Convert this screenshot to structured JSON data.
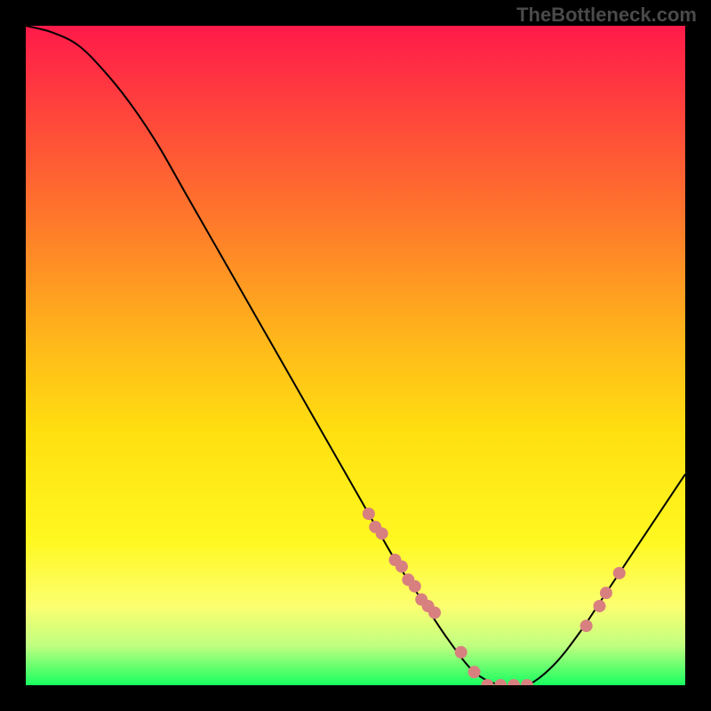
{
  "watermark": "TheBottleneck.com",
  "chart_data": {
    "type": "line",
    "title": "",
    "xlabel": "",
    "ylabel": "",
    "xlim": [
      0,
      100
    ],
    "ylim": [
      0,
      100
    ],
    "description": "V-shaped bottleneck curve over rainbow gradient; y approximates percent bottleneck (0 = green/bottom, 100 = red/top); minimum near x≈70",
    "series": [
      {
        "name": "curve",
        "x": [
          0,
          4,
          8,
          12,
          16,
          20,
          24,
          28,
          32,
          36,
          40,
          44,
          48,
          52,
          56,
          60,
          64,
          68,
          72,
          76,
          80,
          84,
          88,
          92,
          96,
          100
        ],
        "y": [
          100,
          99,
          97,
          93,
          88,
          82,
          75,
          68,
          61,
          54,
          47,
          40,
          33,
          26,
          19,
          13,
          7,
          2,
          0,
          0,
          3,
          8,
          14,
          20,
          26,
          32
        ]
      }
    ],
    "markers": {
      "name": "highlighted-points",
      "x": [
        52,
        53,
        54,
        56,
        57,
        58,
        59,
        60,
        61,
        62,
        66,
        68,
        70,
        72,
        74,
        76,
        85,
        87,
        88,
        90
      ],
      "y": [
        26,
        24,
        23,
        19,
        18,
        16,
        15,
        13,
        12,
        11,
        5,
        2,
        0,
        0,
        0,
        0,
        9,
        12,
        14,
        17
      ]
    }
  }
}
